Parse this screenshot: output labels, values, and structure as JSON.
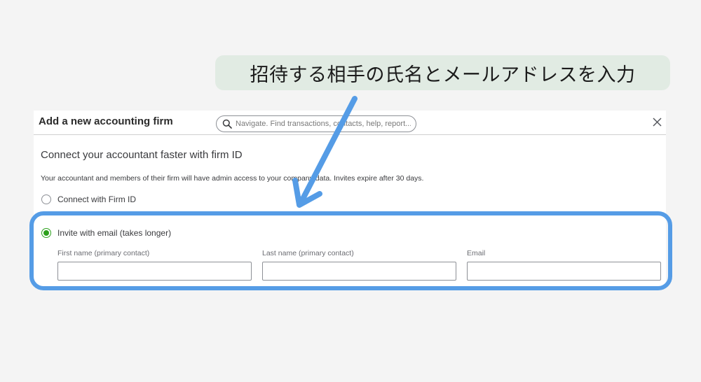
{
  "annotation": {
    "callout_text": "招待する相手の氏名とメールアドレスを入力",
    "highlight_color": "#559ce6",
    "callout_background": "#e1ebe3"
  },
  "dialog": {
    "title": "Add a new accounting firm",
    "search_placeholder": "Navigate. Find transactions, contacts, help, report...",
    "close_icon": "close-icon",
    "heading": "Connect your accountant faster with firm ID",
    "description": "Your accountant and members of their firm will have admin access to your company data. Invites expire after 30 days.",
    "options": [
      {
        "label": "Connect with Firm ID",
        "selected": false
      },
      {
        "label": "Invite with email (takes longer)",
        "selected": true
      }
    ],
    "fields": [
      {
        "label": "First name (primary contact)",
        "value": ""
      },
      {
        "label": "Last name (primary contact)",
        "value": ""
      },
      {
        "label": "Email",
        "value": ""
      }
    ],
    "accent_color": "#2ca01c"
  }
}
